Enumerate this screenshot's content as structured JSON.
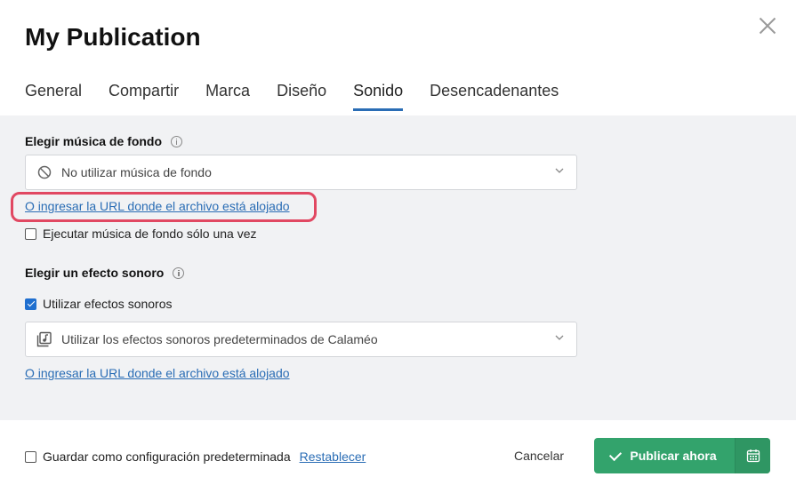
{
  "dialog": {
    "title": "My Publication"
  },
  "tabs": [
    {
      "label": "General"
    },
    {
      "label": "Compartir"
    },
    {
      "label": "Marca"
    },
    {
      "label": "Diseño"
    },
    {
      "label": "Sonido",
      "active": true
    },
    {
      "label": "Desencadenantes"
    }
  ],
  "background_music": {
    "title": "Elegir música de fondo",
    "select_value": "No utilizar música de fondo",
    "select_icon": "no-entry-icon",
    "url_link": "O ingresar la URL donde el archivo está alojado",
    "play_once_label": "Ejecutar música de fondo sólo una vez",
    "play_once_checked": false
  },
  "sound_effects": {
    "title": "Elegir un efecto sonoro",
    "use_effects_label": "Utilizar efectos sonoros",
    "use_effects_checked": true,
    "select_value": "Utilizar los efectos sonoros predeterminados de Calaméo",
    "select_icon": "music-library-icon",
    "url_link": "O ingresar la URL donde el archivo está alojado"
  },
  "footer": {
    "save_default_label": "Guardar como configuración predeterminada",
    "save_default_checked": false,
    "reset_link": "Restablecer",
    "cancel_label": "Cancelar",
    "publish_label": "Publicar ahora"
  },
  "colors": {
    "accent_blue": "#2a6db5",
    "publish_green": "#33a36c",
    "highlight_red": "#e14862",
    "content_bg": "#f1f2f4"
  }
}
